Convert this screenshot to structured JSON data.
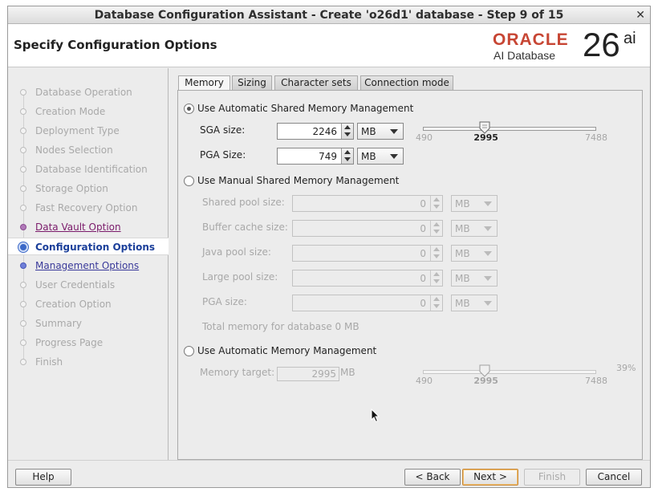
{
  "window": {
    "title": "Database Configuration Assistant - Create 'o26d1' database - Step 9 of 15",
    "close_glyph": "✕"
  },
  "header": {
    "page_title": "Specify Configuration Options",
    "logo": {
      "brand": "ORACLE",
      "product": "AI Database",
      "version": "26",
      "suffix": "ai",
      "brand_color": "#c74634"
    }
  },
  "sidebar": {
    "steps": [
      {
        "label": "Database Operation",
        "state": "done"
      },
      {
        "label": "Creation Mode",
        "state": "done"
      },
      {
        "label": "Deployment Type",
        "state": "done"
      },
      {
        "label": "Nodes Selection",
        "state": "done"
      },
      {
        "label": "Database Identification",
        "state": "done"
      },
      {
        "label": "Storage Option",
        "state": "done"
      },
      {
        "label": "Fast Recovery Option",
        "state": "done"
      },
      {
        "label": "Data Vault Option",
        "state": "visited-link"
      },
      {
        "label": "Configuration Options",
        "state": "current"
      },
      {
        "label": "Management Options",
        "state": "link"
      },
      {
        "label": "User Credentials",
        "state": "pending"
      },
      {
        "label": "Creation Option",
        "state": "pending"
      },
      {
        "label": "Summary",
        "state": "pending"
      },
      {
        "label": "Progress Page",
        "state": "pending"
      },
      {
        "label": "Finish",
        "state": "pending"
      }
    ]
  },
  "tabs": [
    {
      "label": "Memory",
      "active": true
    },
    {
      "label": "Sizing",
      "active": false
    },
    {
      "label": "Character sets",
      "active": false
    },
    {
      "label": "Connection mode",
      "active": false
    }
  ],
  "memory": {
    "asmm": {
      "label": "Use Automatic Shared Memory Management",
      "selected": true,
      "sga": {
        "label": "SGA size:",
        "value": "2246",
        "unit": "MB"
      },
      "pga": {
        "label": "PGA Size:",
        "value": "749",
        "unit": "MB"
      },
      "slider": {
        "min": "490",
        "current": "2995",
        "max": "7488",
        "value": 2995,
        "range": [
          490,
          7488
        ]
      }
    },
    "manual": {
      "label": "Use Manual Shared Memory Management",
      "selected": false,
      "fields": [
        {
          "label": "Shared pool size:",
          "value": "0",
          "unit": "MB"
        },
        {
          "label": "Buffer cache size:",
          "value": "0",
          "unit": "MB"
        },
        {
          "label": "Java pool size:",
          "value": "0",
          "unit": "MB"
        },
        {
          "label": "Large pool size:",
          "value": "0",
          "unit": "MB"
        },
        {
          "label": "PGA size:",
          "value": "0",
          "unit": "MB"
        }
      ],
      "total_text": "Total memory for database 0 MB"
    },
    "amm": {
      "label": "Use Automatic Memory Management",
      "selected": false,
      "target_label": "Memory target:",
      "target_value": "2995",
      "target_unit": "MB",
      "slider": {
        "min": "490",
        "current": "2995",
        "max": "7488",
        "percent": "39%",
        "value": 2995,
        "range": [
          490,
          7488
        ]
      }
    }
  },
  "buttons": {
    "help": "Help",
    "back": "< Back",
    "next": "Next >",
    "finish": "Finish",
    "cancel": "Cancel"
  }
}
